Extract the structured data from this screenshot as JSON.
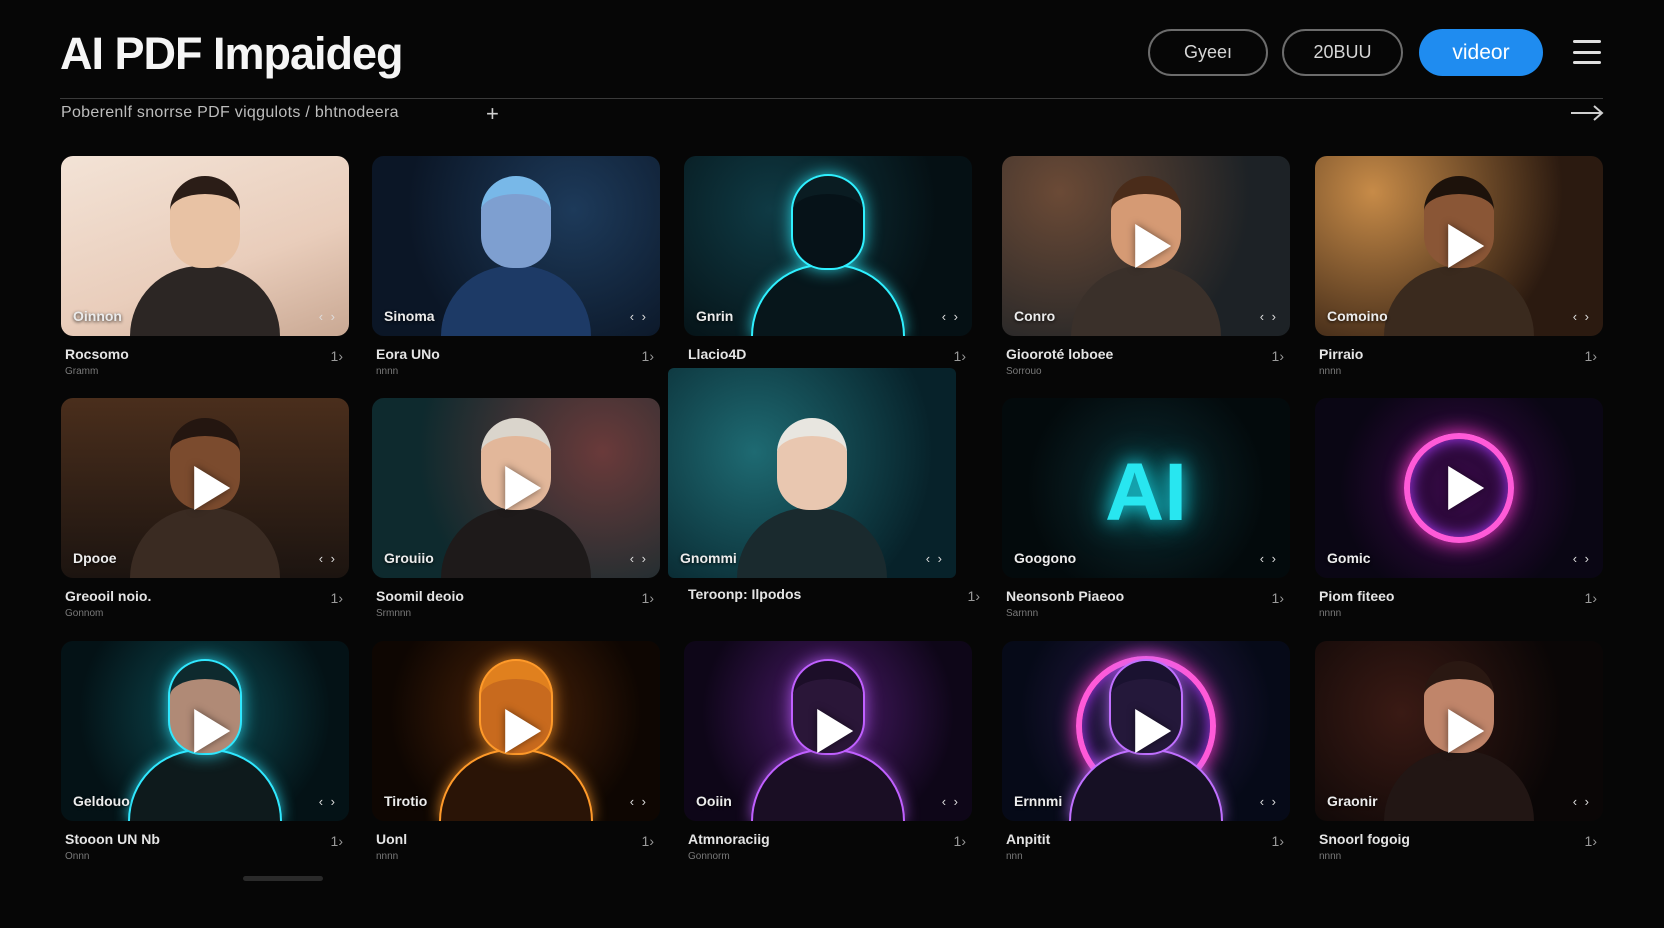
{
  "header": {
    "title": "AI PDF Impaideg",
    "buttons": [
      "Gyeeı",
      "20BUU"
    ],
    "primary_button": "videor",
    "breadcrumb": "Poberenlf snorrse PDF viqgulots / bhtnodeera"
  },
  "colors": {
    "background": "#060606",
    "accent": "#1f8cf0"
  },
  "icons": {
    "menu": "hamburger-icon",
    "add": "plus-icon",
    "next": "arrow-right-icon",
    "play": "play-icon",
    "expand": "expand-icon"
  },
  "cards": [
    {
      "label": "Oinnon",
      "title": "Rocsomo",
      "sub": "Gramm",
      "play": false
    },
    {
      "label": "Sinoma",
      "title": "Eora UNo",
      "sub": "nnnn",
      "play": false
    },
    {
      "label": "Gnrin",
      "title": "Llacio4D",
      "sub": "",
      "play": false
    },
    {
      "label": "Conro",
      "title": "Giooroté loboee",
      "sub": "Sorrouo",
      "play": true
    },
    {
      "label": "Comoino",
      "title": "Pirraio",
      "sub": "nnnn",
      "play": true
    },
    {
      "label": "Dpooe",
      "title": "Greooil noio.",
      "sub": "Gonnom",
      "play": true
    },
    {
      "label": "Grouiio",
      "title": "Soomil deoio",
      "sub": "Srmnnn",
      "play": true
    },
    {
      "label": "Gnommi",
      "title": "Teroonp: Ilpodos",
      "sub": "",
      "play": false
    },
    {
      "label": "Googono",
      "title": "Neonsonb Piaeoo",
      "sub": "Sarnnn",
      "play": false
    },
    {
      "label": "Gomic",
      "title": "Piom fiteeo",
      "sub": "nnnn",
      "play": true
    },
    {
      "label": "Geldouo",
      "title": "Stooon UN Nb",
      "sub": "Onnn",
      "play": true
    },
    {
      "label": "Tirotio",
      "title": "Uonl",
      "sub": "nnnn",
      "play": true
    },
    {
      "label": "Ooiin",
      "title": "Atmnoraciig",
      "sub": "Gonnorm",
      "play": true
    },
    {
      "label": "Ernnmi",
      "title": "Anpitit",
      "sub": "nnn",
      "play": true
    },
    {
      "label": "Graonir",
      "title": "Snoorl fogoig",
      "sub": "nnnn",
      "play": true
    }
  ]
}
